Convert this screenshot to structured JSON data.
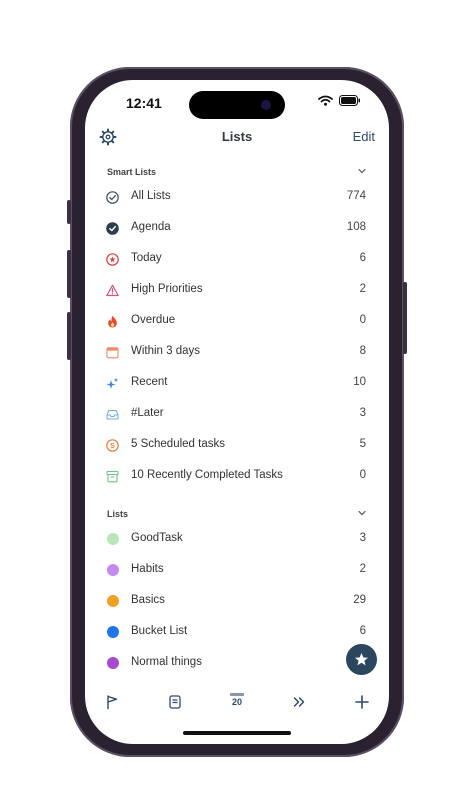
{
  "status": {
    "time": "12:41"
  },
  "nav": {
    "title": "Lists",
    "edit_label": "Edit"
  },
  "smart_lists": {
    "header": "Smart Lists",
    "items": [
      {
        "label": "All Lists",
        "count": "774",
        "icon": "checkmark-circle-outline-icon",
        "color": "#3b4f63"
      },
      {
        "label": "Agenda",
        "count": "108",
        "icon": "checkmark-circle-filled-icon",
        "color": "#2c3e50"
      },
      {
        "label": "Today",
        "count": "6",
        "icon": "star-circle-icon",
        "color": "#e0403a"
      },
      {
        "label": "High Priorities",
        "count": "2",
        "icon": "warning-triangle-icon",
        "color": "#e0507a"
      },
      {
        "label": "Overdue",
        "count": "0",
        "icon": "flame-icon",
        "color": "#e8472b"
      },
      {
        "label": "Within 3 days",
        "count": "8",
        "icon": "calendar-icon",
        "color": "#f08a6a"
      },
      {
        "label": "Recent",
        "count": "10",
        "icon": "sparkles-icon",
        "color": "#3d86e0"
      },
      {
        "label": "#Later",
        "count": "3",
        "icon": "tray-icon",
        "color": "#6fb0e8"
      },
      {
        "label": "5 Scheduled tasks",
        "count": "5",
        "icon": "scheduled-circle-icon",
        "color": "#e57a34"
      },
      {
        "label": "10 Recently Completed Tasks",
        "count": "0",
        "icon": "archive-box-icon",
        "color": "#6cc48a"
      }
    ]
  },
  "lists": {
    "header": "Lists",
    "items": [
      {
        "label": "GoodTask",
        "count": "3",
        "color": "#b8e6b8"
      },
      {
        "label": "Habits",
        "count": "2",
        "color": "#c58af0"
      },
      {
        "label": "Basics",
        "count": "29",
        "color": "#f5a024"
      },
      {
        "label": "Bucket List",
        "count": "6",
        "color": "#1e74e8"
      },
      {
        "label": "Normal things",
        "count": "",
        "color": "#a64ad0"
      }
    ]
  },
  "tabbar": {
    "calendar_day": "20"
  },
  "colors": {
    "accent": "#2c4660",
    "edit": "#2d4a6a"
  }
}
